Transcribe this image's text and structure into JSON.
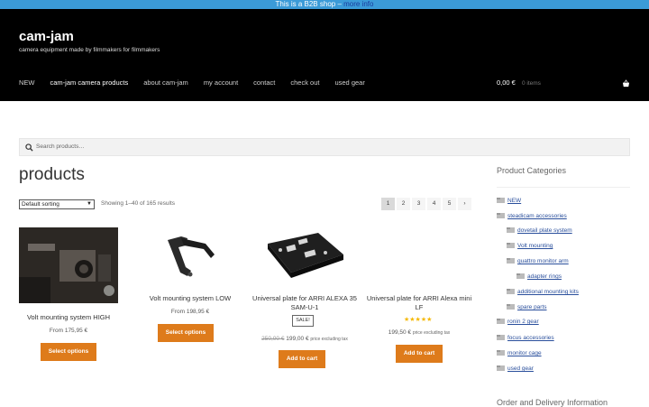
{
  "notice": {
    "text": "This is a B2B shop",
    "more": "more info"
  },
  "site": {
    "title": "cam-jam",
    "tagline": "camera equipment made by filmmakers for filmmakers"
  },
  "nav": [
    "NEW",
    "cam-jam camera products",
    "about cam-jam",
    "my account",
    "contact",
    "check out",
    "used gear"
  ],
  "cart": {
    "total": "0,00 €",
    "items": "0 items",
    "icon": "basket-icon"
  },
  "search": {
    "placeholder": "Search products…",
    "icon": "search-icon"
  },
  "page": {
    "title": "products"
  },
  "sorting": {
    "selected": "Default sorting"
  },
  "result_count": "Showing 1–40 of 165 results",
  "pagination": [
    "1",
    "2",
    "3",
    "4",
    "5",
    "›"
  ],
  "products": [
    {
      "name": "Volt mounting system HIGH",
      "price": "From 175,95 €",
      "button": "Select options"
    },
    {
      "name": "Volt mounting system LOW",
      "price": "From 198,95 €",
      "button": "Select options"
    },
    {
      "name": "Universal plate for ARRI ALEXA 35 SAM-U-1",
      "sale": "SALE!",
      "old_price": "250,00 €",
      "price": "199,00 €",
      "tax_note": "price excluding tax",
      "button": "Add to cart"
    },
    {
      "name": "Universal plate for ARRI Alexa mini LF",
      "rating": 5,
      "price": "199,50 €",
      "tax_note": "price excluding tax",
      "button": "Add to cart"
    }
  ],
  "sidebar": {
    "title": "Product Categories",
    "categories": [
      "NEW",
      "steadicam accessories",
      "dovetail plate system",
      "Volt mounting",
      "quattro monitor arm",
      "adapter rings",
      "additional mounting kits",
      "spare parts",
      "ronin 2 gear",
      "focus accessories",
      "monitor cage",
      "used gear"
    ],
    "next_title": "Order and Delivery Information"
  },
  "colors": {
    "accent": "#de7b1b",
    "header": "#000000",
    "notice": "#3b9bd8",
    "link": "#2a4f9c"
  }
}
